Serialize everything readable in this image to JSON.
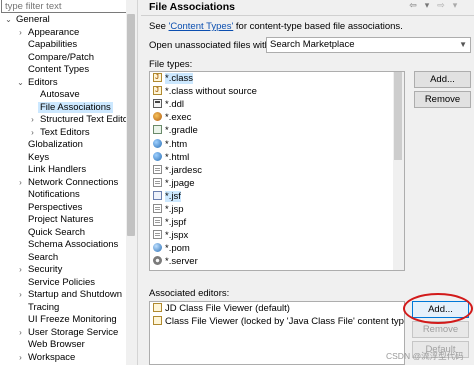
{
  "sidebar": {
    "filter_placeholder": "type filter text",
    "tree": [
      {
        "label": "General",
        "chevron": "v",
        "level": 0
      },
      {
        "label": "Appearance",
        "chevron": ">",
        "level": 1
      },
      {
        "label": "Capabilities",
        "chevron": "",
        "level": 1
      },
      {
        "label": "Compare/Patch",
        "chevron": "",
        "level": 1
      },
      {
        "label": "Content Types",
        "chevron": "",
        "level": 1
      },
      {
        "label": "Editors",
        "chevron": "v",
        "level": 1
      },
      {
        "label": "Autosave",
        "chevron": "",
        "level": 2
      },
      {
        "label": "File Associations",
        "chevron": "",
        "level": 2,
        "selected": true
      },
      {
        "label": "Structured Text Editor",
        "chevron": ">",
        "level": 2
      },
      {
        "label": "Text Editors",
        "chevron": ">",
        "level": 2
      },
      {
        "label": "Globalization",
        "chevron": "",
        "level": 1
      },
      {
        "label": "Keys",
        "chevron": "",
        "level": 1
      },
      {
        "label": "Link Handlers",
        "chevron": "",
        "level": 1
      },
      {
        "label": "Network Connections",
        "chevron": ">",
        "level": 1
      },
      {
        "label": "Notifications",
        "chevron": "",
        "level": 1
      },
      {
        "label": "Perspectives",
        "chevron": "",
        "level": 1
      },
      {
        "label": "Project Natures",
        "chevron": "",
        "level": 1
      },
      {
        "label": "Quick Search",
        "chevron": "",
        "level": 1
      },
      {
        "label": "Schema Associations",
        "chevron": "",
        "level": 1
      },
      {
        "label": "Search",
        "chevron": "",
        "level": 1
      },
      {
        "label": "Security",
        "chevron": ">",
        "level": 1
      },
      {
        "label": "Service Policies",
        "chevron": "",
        "level": 1
      },
      {
        "label": "Startup and Shutdown",
        "chevron": ">",
        "level": 1
      },
      {
        "label": "Tracing",
        "chevron": "",
        "level": 1
      },
      {
        "label": "UI Freeze Monitoring",
        "chevron": "",
        "level": 1
      },
      {
        "label": "User Storage Service",
        "chevron": ">",
        "level": 1
      },
      {
        "label": "Web Browser",
        "chevron": "",
        "level": 1
      },
      {
        "label": "Workspace",
        "chevron": ">",
        "level": 1
      }
    ]
  },
  "header": {
    "title": "File Associations",
    "back_arrow": "⇦",
    "back_menu": "▾",
    "forward_arrow": "⇨",
    "forward_menu": "▾"
  },
  "description": {
    "prefix": "See ",
    "link": "'Content Types'",
    "suffix": " for content-type based file associations."
  },
  "unassociated": {
    "label": "Open unassociated files with:",
    "selected": "Search Marketplace"
  },
  "file_types": {
    "label": "File types:",
    "items": [
      {
        "text": "*.class",
        "icon": "class-icon",
        "selected": true
      },
      {
        "text": "*.class without source",
        "icon": "class-icon"
      },
      {
        "text": "*.ddl",
        "icon": "database-icon"
      },
      {
        "text": "*.exec",
        "icon": "exec-icon"
      },
      {
        "text": "*.gradle",
        "icon": "gradle-icon"
      },
      {
        "text": "*.htm",
        "icon": "globe-icon"
      },
      {
        "text": "*.html",
        "icon": "globe-icon"
      },
      {
        "text": "*.jardesc",
        "icon": "file-icon"
      },
      {
        "text": "*.jpage",
        "icon": "file-icon"
      },
      {
        "text": "*.jsf",
        "icon": "jsf-icon",
        "selected": true
      },
      {
        "text": "*.jsp",
        "icon": "file-icon"
      },
      {
        "text": "*.jspf",
        "icon": "file-icon"
      },
      {
        "text": "*.jspx",
        "icon": "file-icon"
      },
      {
        "text": "*.pom",
        "icon": "pom-icon"
      },
      {
        "text": "*.server",
        "icon": "gear-icon"
      }
    ],
    "add_label": "Add...",
    "remove_label": "Remove"
  },
  "associated_editors": {
    "label": "Associated editors:",
    "items": [
      {
        "text": "JD Class File Viewer (default)",
        "icon": "viewer-icon"
      },
      {
        "text": "Class File Viewer (locked by 'Java Class File' content type)",
        "icon": "viewer-icon"
      }
    ],
    "add_label": "Add...",
    "remove_label": "Remove",
    "default_label": "Default"
  },
  "watermark": "CSDN @流浮型代码",
  "colors": {
    "selection": "#cce8ff",
    "link": "#0b4fb0",
    "highlight_ring": "#d21a1a"
  }
}
